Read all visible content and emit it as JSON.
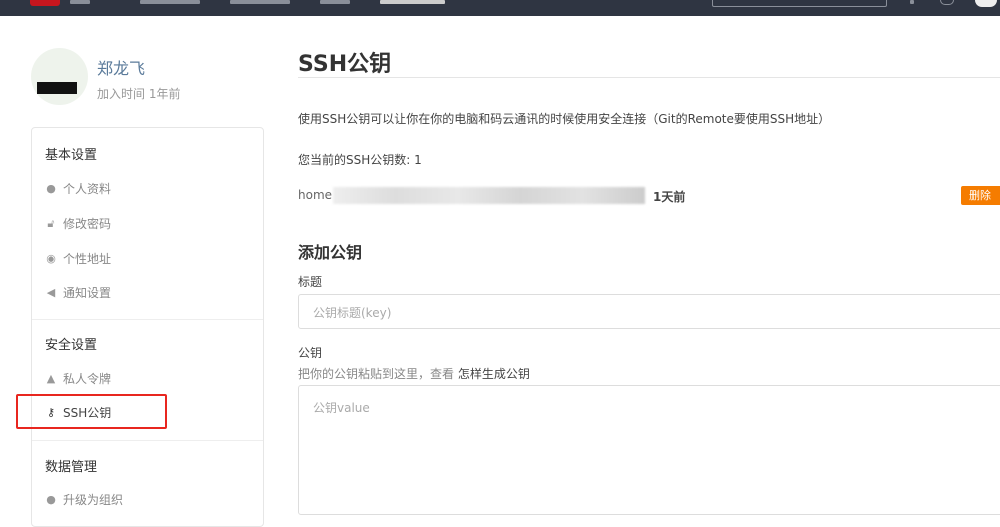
{
  "user": {
    "name": "郑龙飞",
    "joined": "加入时间 1年前"
  },
  "sidebar": {
    "sections": [
      {
        "title": "基本设置",
        "items": [
          {
            "label": "个人资料",
            "icon": "user-icon"
          },
          {
            "label": "修改密码",
            "icon": "lock-icon"
          },
          {
            "label": "个性地址",
            "icon": "compass-icon"
          },
          {
            "label": "通知设置",
            "icon": "volume-icon"
          }
        ]
      },
      {
        "title": "安全设置",
        "items": [
          {
            "label": "私人令牌",
            "icon": "token-icon"
          },
          {
            "label": "SSH公钥",
            "icon": "key-icon"
          }
        ]
      },
      {
        "title": "数据管理",
        "items": [
          {
            "label": "升级为组织",
            "icon": "group-icon"
          }
        ]
      }
    ]
  },
  "main": {
    "title": "SSH公钥",
    "description": "使用SSH公钥可以让你在你的电脑和码云通讯的时候使用安全连接（Git的Remote要使用SSH地址）",
    "count_label": "您当前的SSH公钥数: 1",
    "keys": [
      {
        "name": "home",
        "time": "1天前",
        "delete_label": "删除"
      }
    ],
    "add": {
      "heading": "添加公钥",
      "title_label": "标题",
      "title_placeholder": "公钥标题(key)",
      "key_label": "公钥",
      "key_hint": "把你的公钥粘贴到这里，查看",
      "key_hint_link": "怎样生成公钥",
      "key_placeholder": "公钥value"
    }
  },
  "colors": {
    "topbar": "#2f3542",
    "delete": "#f57c00",
    "highlight": "#e8261f"
  }
}
